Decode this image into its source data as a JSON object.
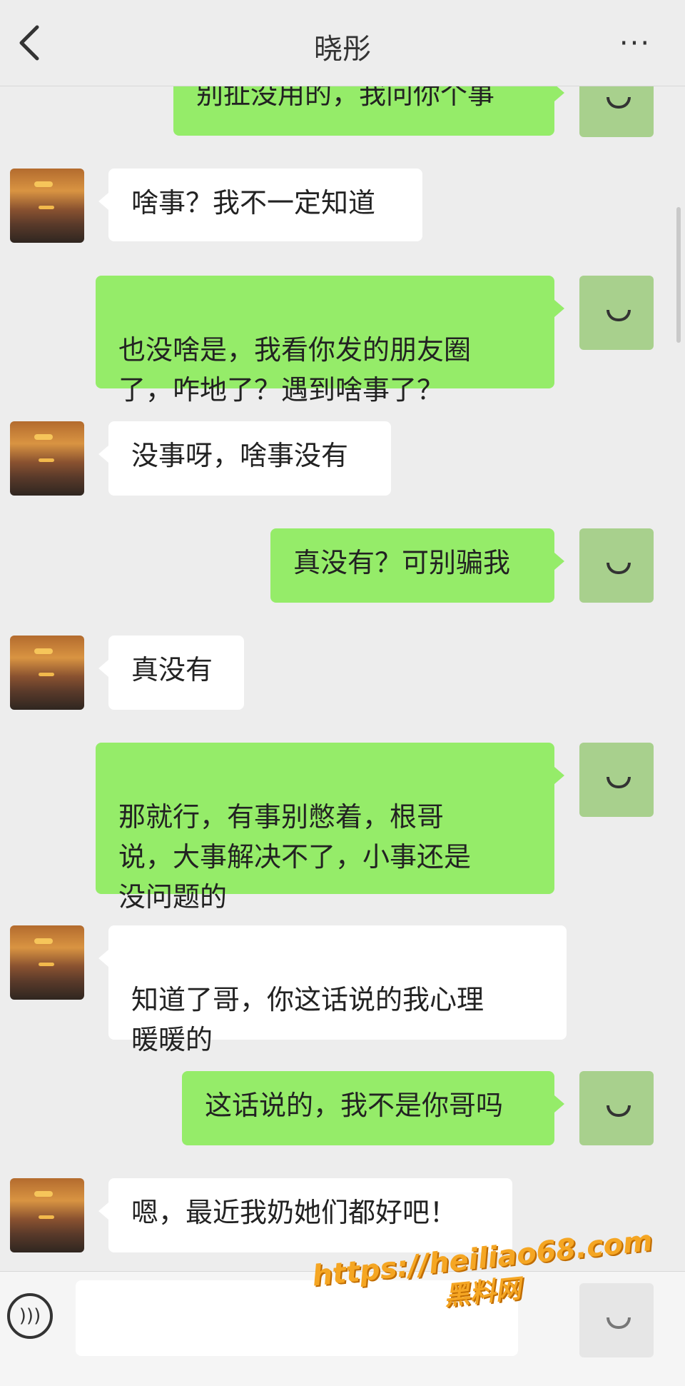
{
  "header": {
    "title": "晓彤",
    "more_label": "···"
  },
  "messages": [
    {
      "from": "me",
      "text": "别扯没用的，我问你个事"
    },
    {
      "from": "them",
      "text": "啥事？我不一定知道"
    },
    {
      "from": "me",
      "text": "也没啥是，我看你发的朋友圈\n了，咋地了？遇到啥事了？"
    },
    {
      "from": "them",
      "text": "没事呀，啥事没有"
    },
    {
      "from": "me",
      "text": "真没有？可别骗我"
    },
    {
      "from": "them",
      "text": "真没有"
    },
    {
      "from": "me",
      "text": "那就行，有事别憋着，根哥\n说，大事解决不了，小事还是\n没问题的"
    },
    {
      "from": "them",
      "text": "知道了哥，你这话说的我心理\n暖暖的"
    },
    {
      "from": "me",
      "text": "这话说的，我不是你哥吗"
    },
    {
      "from": "them",
      "text": "嗯，最近我奶她们都好吧！"
    }
  ],
  "watermark": {
    "url": "https://heiliao68.com",
    "brand": "黑料网"
  },
  "colors": {
    "background": "#ededed",
    "my_bubble": "#95ec69",
    "their_bubble": "#ffffff",
    "watermark": "#f5a623"
  },
  "icons": {
    "back": "chevron-left-icon",
    "more": "more-dots-icon",
    "voice": "voice-icon",
    "emoji": "emoji-icon"
  }
}
